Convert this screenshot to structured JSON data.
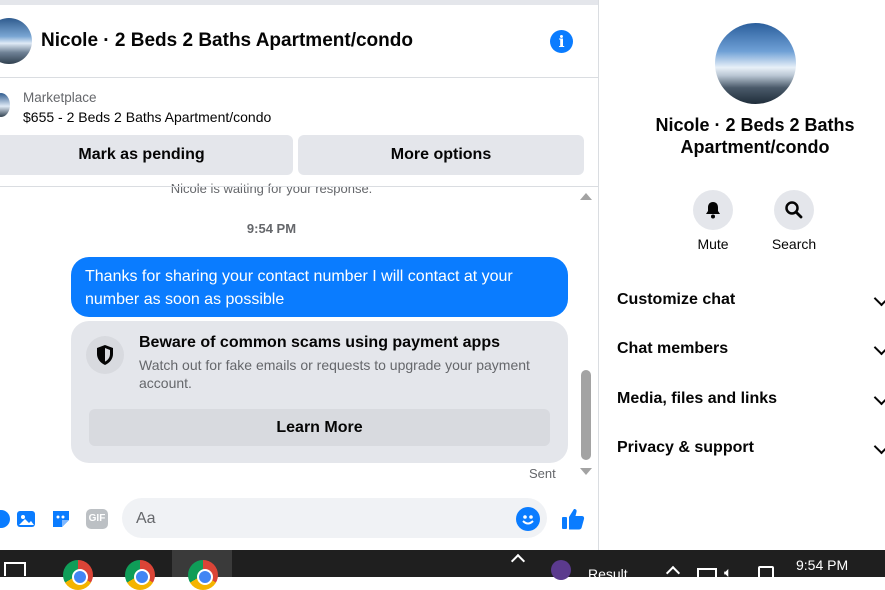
{
  "header": {
    "title": "Nicole · 2 Beds 2 Baths Apartment/condo",
    "info_glyph": "i"
  },
  "marketplace": {
    "label": "Marketplace",
    "listing": "$655 - 2 Beds 2 Baths Apartment/condo",
    "mark_pending_label": "Mark as pending",
    "more_options_label": "More options"
  },
  "chat": {
    "waiting_text": "Nicole is waiting for your response.",
    "timestamp": "9:54 PM",
    "message": "Thanks for sharing your contact number I will contact at your number as soon as possible",
    "scam_card": {
      "title": "Beware of common scams using payment apps",
      "description": "Watch out for fake emails or requests to upgrade your payment account.",
      "button_label": "Learn More"
    },
    "status": "Sent"
  },
  "composer": {
    "placeholder": "Aa",
    "gif_label": "GIF",
    "icons": [
      "plus-icon",
      "photo-icon",
      "sticker-icon",
      "gif-icon",
      "emoji-icon",
      "thumbs-up-icon"
    ]
  },
  "profile": {
    "name": "Nicole · 2 Beds 2 Baths Apartment/condo",
    "actions": [
      {
        "label": "Mute",
        "icon": "bell-icon"
      },
      {
        "label": "Search",
        "icon": "search-icon"
      }
    ],
    "menu": [
      "Customize chat",
      "Chat members",
      "Media, files and links",
      "Privacy & support"
    ]
  },
  "taskbar": {
    "result_label": "Result",
    "time": "9:54 PM"
  },
  "colors": {
    "accent": "#0a7cff",
    "bubble_grey": "#e4e6eb",
    "secondary_text": "#65676b"
  }
}
